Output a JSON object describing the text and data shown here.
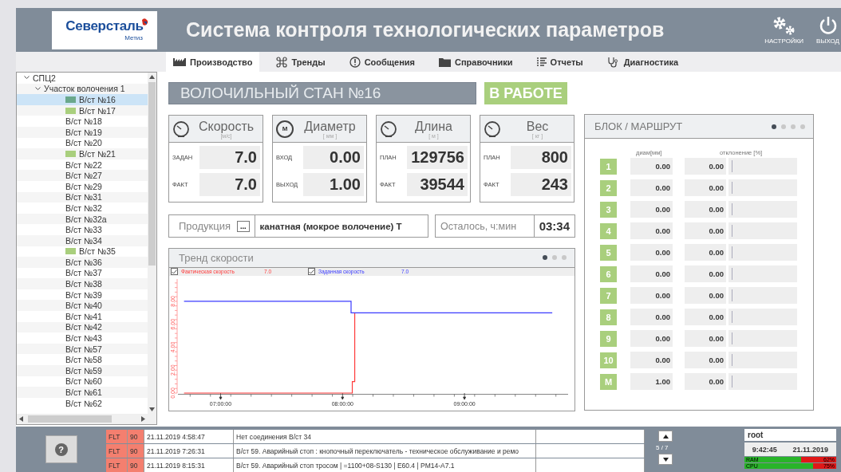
{
  "header": {
    "logo": {
      "brand": "Северсталь",
      "sub": "Метиз"
    },
    "title": "Система контроля технологических параметров",
    "buttons": [
      {
        "kind": "settings",
        "label": "НАСТРОЙКИ"
      },
      {
        "kind": "exit",
        "label": "ВЫХОД"
      }
    ]
  },
  "tabs": [
    {
      "kind": "factory",
      "label": "Производство",
      "selected": true
    },
    {
      "kind": "command",
      "label": "Тренды",
      "selected": false
    },
    {
      "kind": "alert",
      "label": "Сообщения",
      "selected": false
    },
    {
      "kind": "folder",
      "label": "Справочники",
      "selected": false
    },
    {
      "kind": "list",
      "label": "Отчеты",
      "selected": false
    },
    {
      "kind": "stethoscope",
      "label": "Диагностика",
      "selected": false
    }
  ],
  "tree": [
    {
      "label": "СПЦ2",
      "expanded": true,
      "children": [
        {
          "label": "Участок волочения 1",
          "expanded": true,
          "children": [
            {
              "label": "В/ст №16",
              "color": "#6aa88c",
              "selected": true
            },
            {
              "label": "В/ст №17",
              "color": "#a9cf7d",
              "selected": false
            },
            {
              "label": "В/ст №18",
              "selected": false
            },
            {
              "label": "В/ст №19",
              "selected": false
            },
            {
              "label": "В/ст №20",
              "selected": false
            },
            {
              "label": "В/ст №21",
              "color": "#a9cf7d",
              "selected": false
            },
            {
              "label": "В/ст №22",
              "selected": false
            },
            {
              "label": "В/ст №27",
              "selected": false
            },
            {
              "label": "В/ст №29",
              "selected": false
            },
            {
              "label": "В/ст №31",
              "selected": false
            },
            {
              "label": "В/ст №32",
              "selected": false
            },
            {
              "label": "В/ст №32а",
              "selected": false
            },
            {
              "label": "В/ст №33",
              "selected": false
            },
            {
              "label": "В/ст №34",
              "selected": false
            },
            {
              "label": "В/ст №35",
              "color": "#a9cf7d",
              "selected": false
            },
            {
              "label": "В/ст №36",
              "selected": false
            },
            {
              "label": "В/ст №37",
              "selected": false
            },
            {
              "label": "В/ст №38",
              "selected": false
            },
            {
              "label": "В/ст №39",
              "selected": false
            },
            {
              "label": "В/ст №40",
              "selected": false
            },
            {
              "label": "В/ст №41",
              "selected": false
            },
            {
              "label": "В/ст №42",
              "selected": false
            },
            {
              "label": "В/ст №43",
              "selected": false
            },
            {
              "label": "В/ст №57",
              "selected": false
            },
            {
              "label": "В/ст №58",
              "selected": false
            },
            {
              "label": "В/ст №59",
              "selected": false
            },
            {
              "label": "В/ст №60",
              "selected": false
            },
            {
              "label": "В/ст №61",
              "selected": false
            },
            {
              "label": "В/ст №62",
              "selected": false
            }
          ]
        }
      ]
    }
  ],
  "mill": {
    "title": "ВОЛОЧИЛЬНЫЙ СТАН №16",
    "status": "В РАБОТЕ"
  },
  "gauges": [
    {
      "kind": "dial",
      "title": "Скорость",
      "unit": "[м/с]",
      "rows": [
        {
          "label": "ЗАДАН",
          "value": "7.0"
        },
        {
          "label": "ФАКТ",
          "value": "7.0"
        }
      ]
    },
    {
      "kind": "letter",
      "letter": "М",
      "title": "Диаметр",
      "unit": "[ мм ]",
      "rows": [
        {
          "label": "ВХОД",
          "value": "0.00"
        },
        {
          "label": "ВЫХОД",
          "value": "1.00"
        }
      ]
    },
    {
      "kind": "dial",
      "title": "Длина",
      "unit": "[ м ]",
      "rows": [
        {
          "label": "ПЛАН",
          "value": "129756"
        },
        {
          "label": "ФАКТ",
          "value": "39544"
        }
      ]
    },
    {
      "kind": "dial",
      "title": "Вес",
      "unit": "[ кг ]",
      "rows": [
        {
          "label": "ПЛАН",
          "value": "800"
        },
        {
          "label": "ФАКТ",
          "value": "243"
        }
      ]
    }
  ],
  "product": {
    "label": "Продукция",
    "button": "...",
    "value": "канатная (мокрое волочение) Т"
  },
  "remaining": {
    "label": "Осталось, ч:мин",
    "value": "03:34"
  },
  "trend": {
    "title": "Тренд скорости",
    "pages": [
      {
        "selected": true
      },
      {
        "selected": false
      },
      {
        "selected": false
      }
    ],
    "legend": [
      {
        "value": "7.0",
        "checked": true
      },
      {
        "value": "7.0",
        "checked": true
      }
    ],
    "chart_data": {
      "type": "line",
      "x": [
        6.7,
        8.07,
        8.07,
        8.08,
        8.08,
        8.1,
        8.1,
        9.72
      ],
      "series": [
        {
          "name": "Фактическая скорость",
          "color": "#ff3b3b",
          "values": [
            0,
            0,
            0,
            0,
            1,
            1,
            7,
            null
          ]
        },
        {
          "name": "Заданная скорость",
          "color": "#3b3bff",
          "values": [
            8,
            8,
            7,
            7,
            7,
            7,
            7,
            7
          ]
        }
      ],
      "xlim": [
        6.65,
        9.85
      ],
      "ylim": [
        0,
        9.8
      ],
      "xticks": [
        {
          "value": 7,
          "label": "07:00:00"
        },
        {
          "value": 8,
          "label": "08:00:00"
        },
        {
          "value": 9,
          "label": "09:00:00"
        }
      ],
      "yticks": [
        {
          "value": 0,
          "label": "0.00"
        },
        {
          "value": 2,
          "label": "2.00"
        },
        {
          "value": 4,
          "label": "4.00"
        },
        {
          "value": 6,
          "label": "6.00"
        },
        {
          "value": 8,
          "label": "8.00"
        }
      ]
    }
  },
  "route": {
    "title": "БЛОК / МАРШРУТ",
    "pages": [
      {
        "selected": true
      },
      {
        "selected": false
      },
      {
        "selected": false
      },
      {
        "selected": false
      }
    ],
    "columns": [
      "диам[мм]",
      "отклонение [%]"
    ],
    "rows": [
      {
        "block": "1",
        "diam": "0.00",
        "dev": "0.00",
        "level": 0
      },
      {
        "block": "2",
        "diam": "0.00",
        "dev": "0.00",
        "level": 0
      },
      {
        "block": "3",
        "diam": "0.00",
        "dev": "0.00",
        "level": 0
      },
      {
        "block": "4",
        "diam": "0.00",
        "dev": "0.00",
        "level": 0
      },
      {
        "block": "5",
        "diam": "0.00",
        "dev": "0.00",
        "level": 0
      },
      {
        "block": "6",
        "diam": "0.00",
        "dev": "0.00",
        "level": 0
      },
      {
        "block": "7",
        "diam": "0.00",
        "dev": "0.00",
        "level": 0
      },
      {
        "block": "8",
        "diam": "0.00",
        "dev": "0.00",
        "level": 0
      },
      {
        "block": "9",
        "diam": "0.00",
        "dev": "0.00",
        "level": 0
      },
      {
        "block": "10",
        "diam": "0.00",
        "dev": "0.00",
        "level": 0
      },
      {
        "block": "М",
        "diam": "1.00",
        "dev": "0.00",
        "level": 0
      }
    ]
  },
  "footer": {
    "help": "?",
    "alarms": [
      {
        "code": "FLT",
        "priority": "90",
        "time": "21.11.2019 4:58:47",
        "text": "Нет соединения В/ст 34"
      },
      {
        "code": "FLT",
        "priority": "90",
        "time": "21.11.2019 7:26:31",
        "text": "В/ст 59. Аварийный стоп :  кнопочный переключатель - техническое обслуживание и ремо"
      },
      {
        "code": "FLT",
        "priority": "90",
        "time": "21.11.2019 8:15:31",
        "text": "В/ст 59. Аварийный стоп тросом | =1100+08-S130 | E60.4 | PM14-A7.1"
      }
    ],
    "pager": "5 / 7",
    "user": "root",
    "time": "9:42:45",
    "date": "21.11.2019",
    "meters": [
      {
        "label": "RAM",
        "reading": "62%",
        "level": 0.62
      },
      {
        "label": "CPU",
        "reading": "75%",
        "level": 0.75
      }
    ]
  }
}
